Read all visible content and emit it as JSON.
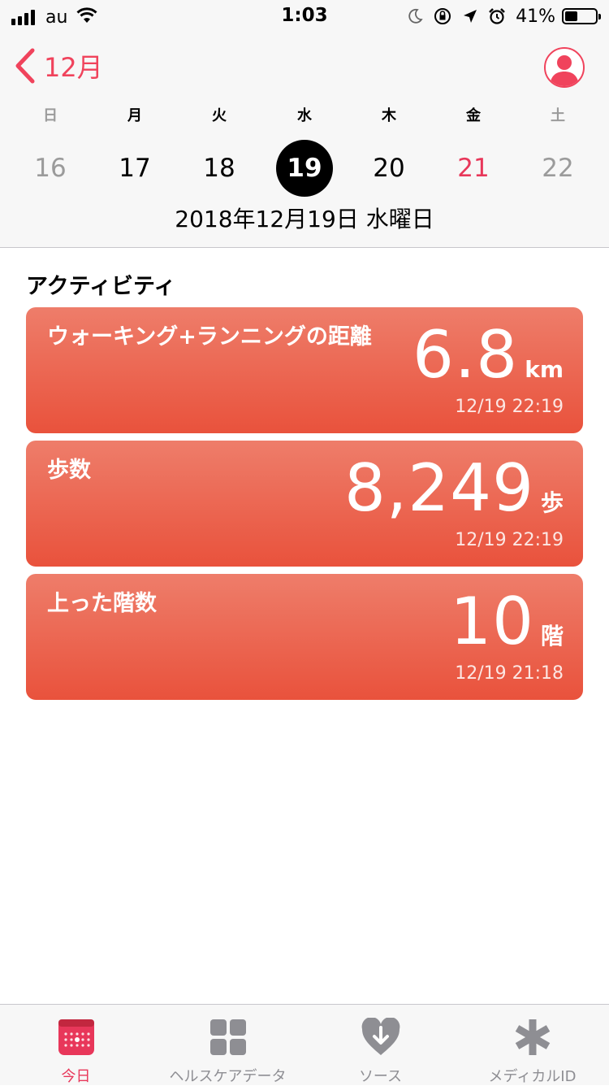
{
  "status_bar": {
    "carrier": "au",
    "time": "1:03",
    "battery_percent": "41%",
    "battery_level": 0.41
  },
  "nav": {
    "back_label": "12月",
    "back_icon": "chevron-left-icon",
    "profile_icon": "person-icon",
    "accent_color": "#f0435c"
  },
  "calendar": {
    "weekdays": [
      "日",
      "月",
      "火",
      "水",
      "木",
      "金",
      "土"
    ],
    "dates": [
      "16",
      "17",
      "18",
      "19",
      "20",
      "21",
      "22"
    ],
    "selected_date": "19",
    "full_date": "2018年12月19日 水曜日"
  },
  "activity": {
    "section_title": "アクティビティ",
    "cards": [
      {
        "title": "ウォーキング+ランニングの距離",
        "value": "6.8",
        "unit": "km",
        "time": "12/19 22:19"
      },
      {
        "title": "歩数",
        "value": "8,249",
        "unit": "歩",
        "time": "12/19 22:19"
      },
      {
        "title": "上った階数",
        "value": "10",
        "unit": "階",
        "time": "12/19 21:18"
      }
    ],
    "card_color": "#e9523c"
  },
  "tabbar": {
    "tabs": [
      {
        "label": "今日",
        "icon": "calendar-today-icon",
        "active": true
      },
      {
        "label": "ヘルスケアデータ",
        "icon": "grid-icon",
        "active": false
      },
      {
        "label": "ソース",
        "icon": "heart-download-icon",
        "active": false
      },
      {
        "label": "メディカルID",
        "icon": "asterisk-icon",
        "active": false
      }
    ]
  }
}
